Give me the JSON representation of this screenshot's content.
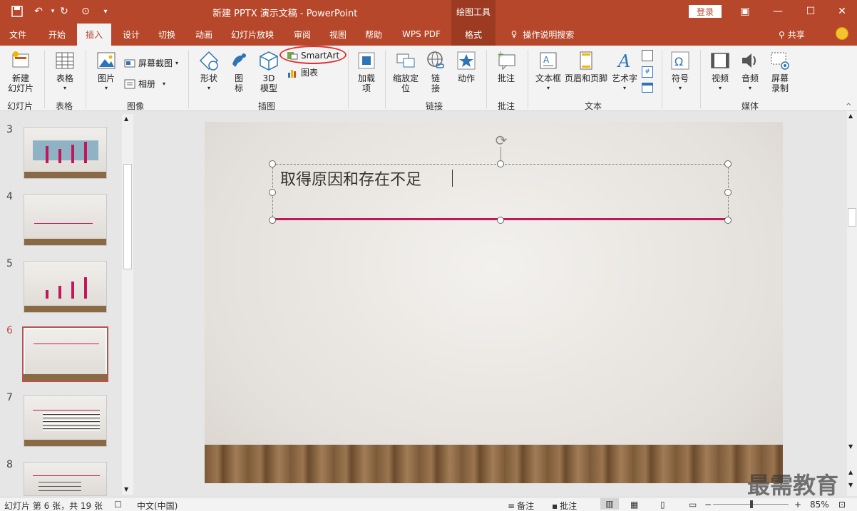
{
  "window": {
    "title": "新建 PPTX 演示文稿 - PowerPoint",
    "context_label": "绘图工具",
    "login_label": "登录"
  },
  "tabs": [
    "文件",
    "开始",
    "插入",
    "设计",
    "切换",
    "动画",
    "幻灯片放映",
    "审阅",
    "视图",
    "帮助",
    "WPS PDF",
    "格式"
  ],
  "tell_me": "操作说明搜索",
  "share_label": "共享",
  "ribbon": {
    "new_slide": "新建\n幻灯片",
    "table": "表格",
    "picture": "图片",
    "screenshot": "屏幕截图",
    "album": "相册",
    "shapes": "形状",
    "icons": "图\n标",
    "model3d": "3D\n模型",
    "smartart": "SmartArt",
    "chart": "图表",
    "addins": "加载\n项",
    "zoom": "缩放定\n位",
    "link": "链\n接",
    "action": "动作",
    "comment": "批注",
    "textbox": "文本框",
    "header_footer": "页眉和页脚",
    "wordart": "艺术字",
    "symbol": "符号",
    "video": "视频",
    "audio": "音频",
    "screen_record": "屏幕\n录制",
    "groups": {
      "slides": "幻灯片",
      "tables": "表格",
      "images": "图像",
      "illustrations": "插图",
      "links": "链接",
      "comments": "批注",
      "text": "文本",
      "media": "媒体"
    }
  },
  "slides": [
    {
      "number": "3"
    },
    {
      "number": "4"
    },
    {
      "number": "5"
    },
    {
      "number": "6"
    },
    {
      "number": "7"
    },
    {
      "number": "8"
    }
  ],
  "current_slide": {
    "title": "取得原因和存在不足"
  },
  "watermark": "最需教育",
  "status": {
    "slide_info": "幻灯片 第 6 张，共 19 张",
    "language": "中文(中国)",
    "notes": "备注",
    "comments": "批注",
    "zoom": "85%"
  },
  "colors": {
    "accent": "#b7472a",
    "highlight_circle": "#e03030",
    "title_underline": "#c2185b"
  }
}
